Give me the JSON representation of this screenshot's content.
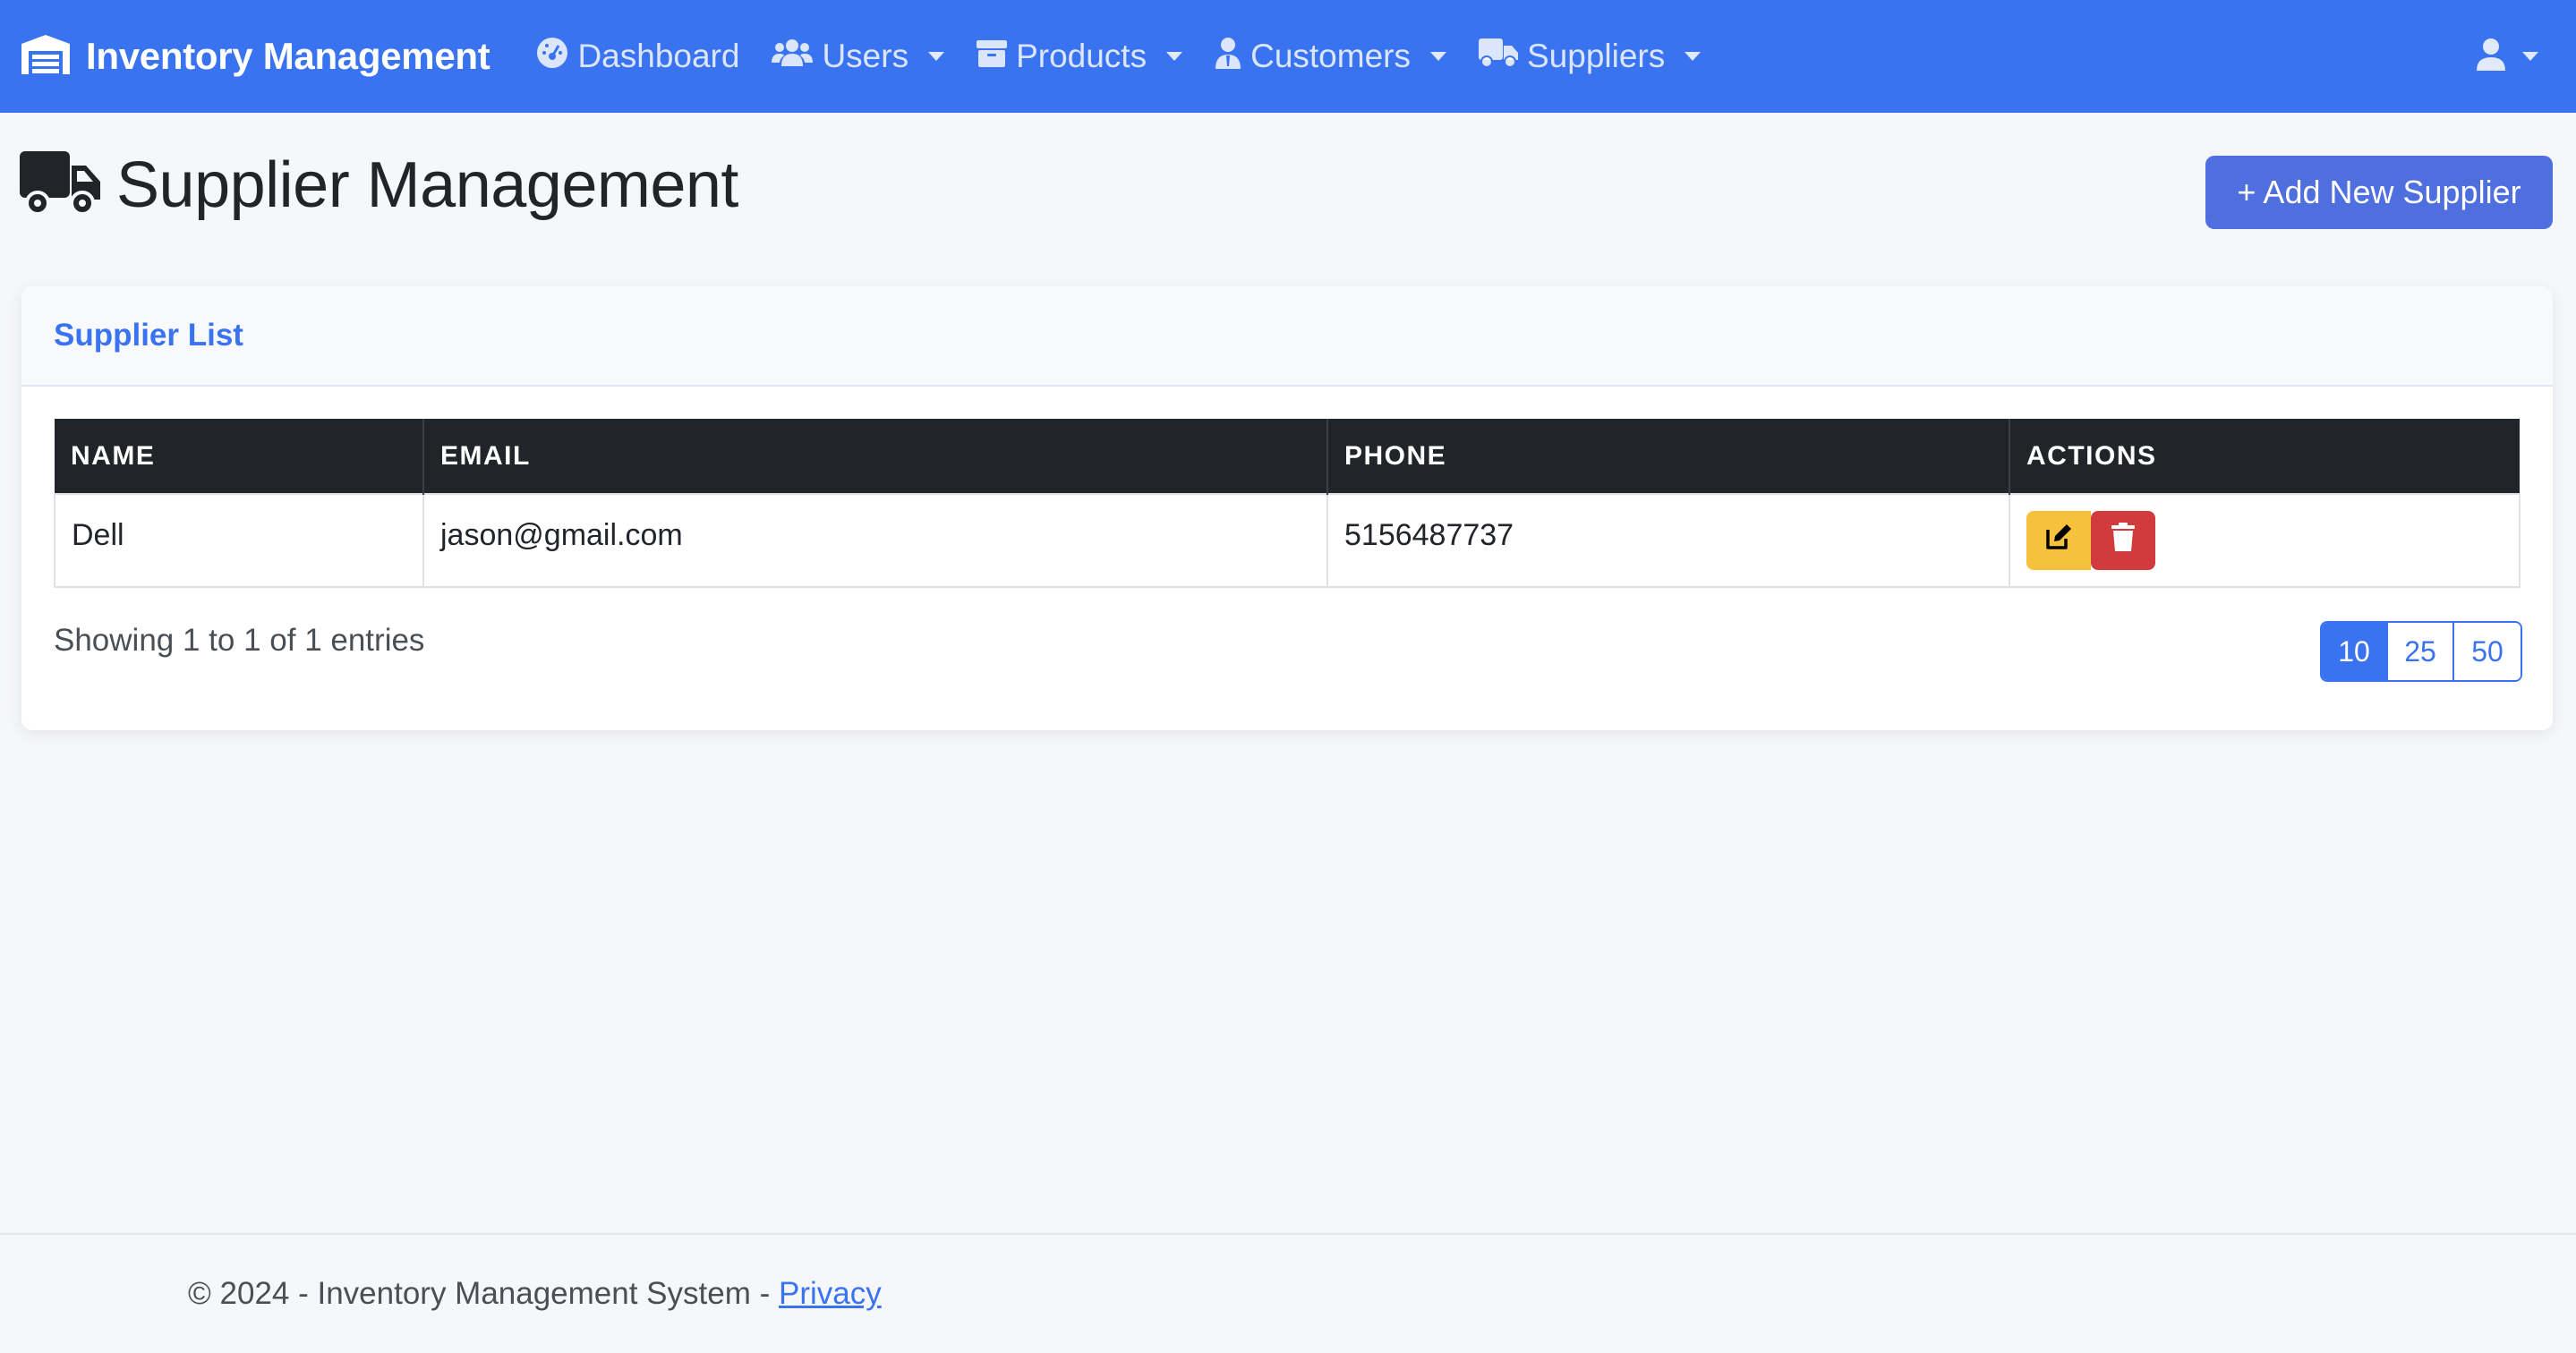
{
  "navbar": {
    "brand": "Inventory Management",
    "items": [
      {
        "label": "Dashboard",
        "icon": "dashboard-icon",
        "dropdown": false
      },
      {
        "label": "Users",
        "icon": "users-icon",
        "dropdown": true
      },
      {
        "label": "Products",
        "icon": "box-icon",
        "dropdown": true
      },
      {
        "label": "Customers",
        "icon": "customer-icon",
        "dropdown": true
      },
      {
        "label": "Suppliers",
        "icon": "truck-icon",
        "dropdown": true
      }
    ],
    "user_icon": "user-icon"
  },
  "page": {
    "title": "Supplier Management",
    "add_button": "+ Add New Supplier"
  },
  "card": {
    "title": "Supplier List",
    "table": {
      "headers": [
        "NAME",
        "EMAIL",
        "PHONE",
        "ACTIONS"
      ],
      "rows": [
        {
          "name": "Dell",
          "email": "jason@gmail.com",
          "phone": "5156487737"
        }
      ]
    },
    "info": "Showing 1 to 1 of 1 entries",
    "page_sizes": [
      "10",
      "25",
      "50"
    ],
    "active_page_size": "10"
  },
  "footer": {
    "text": "© 2024 - Inventory Management System - ",
    "link": "Privacy"
  },
  "colors": {
    "primary": "#3a73f0",
    "add_button": "#4f6fde",
    "edit": "#f6c23e",
    "delete": "#d13b3b",
    "table_header": "#212529"
  }
}
